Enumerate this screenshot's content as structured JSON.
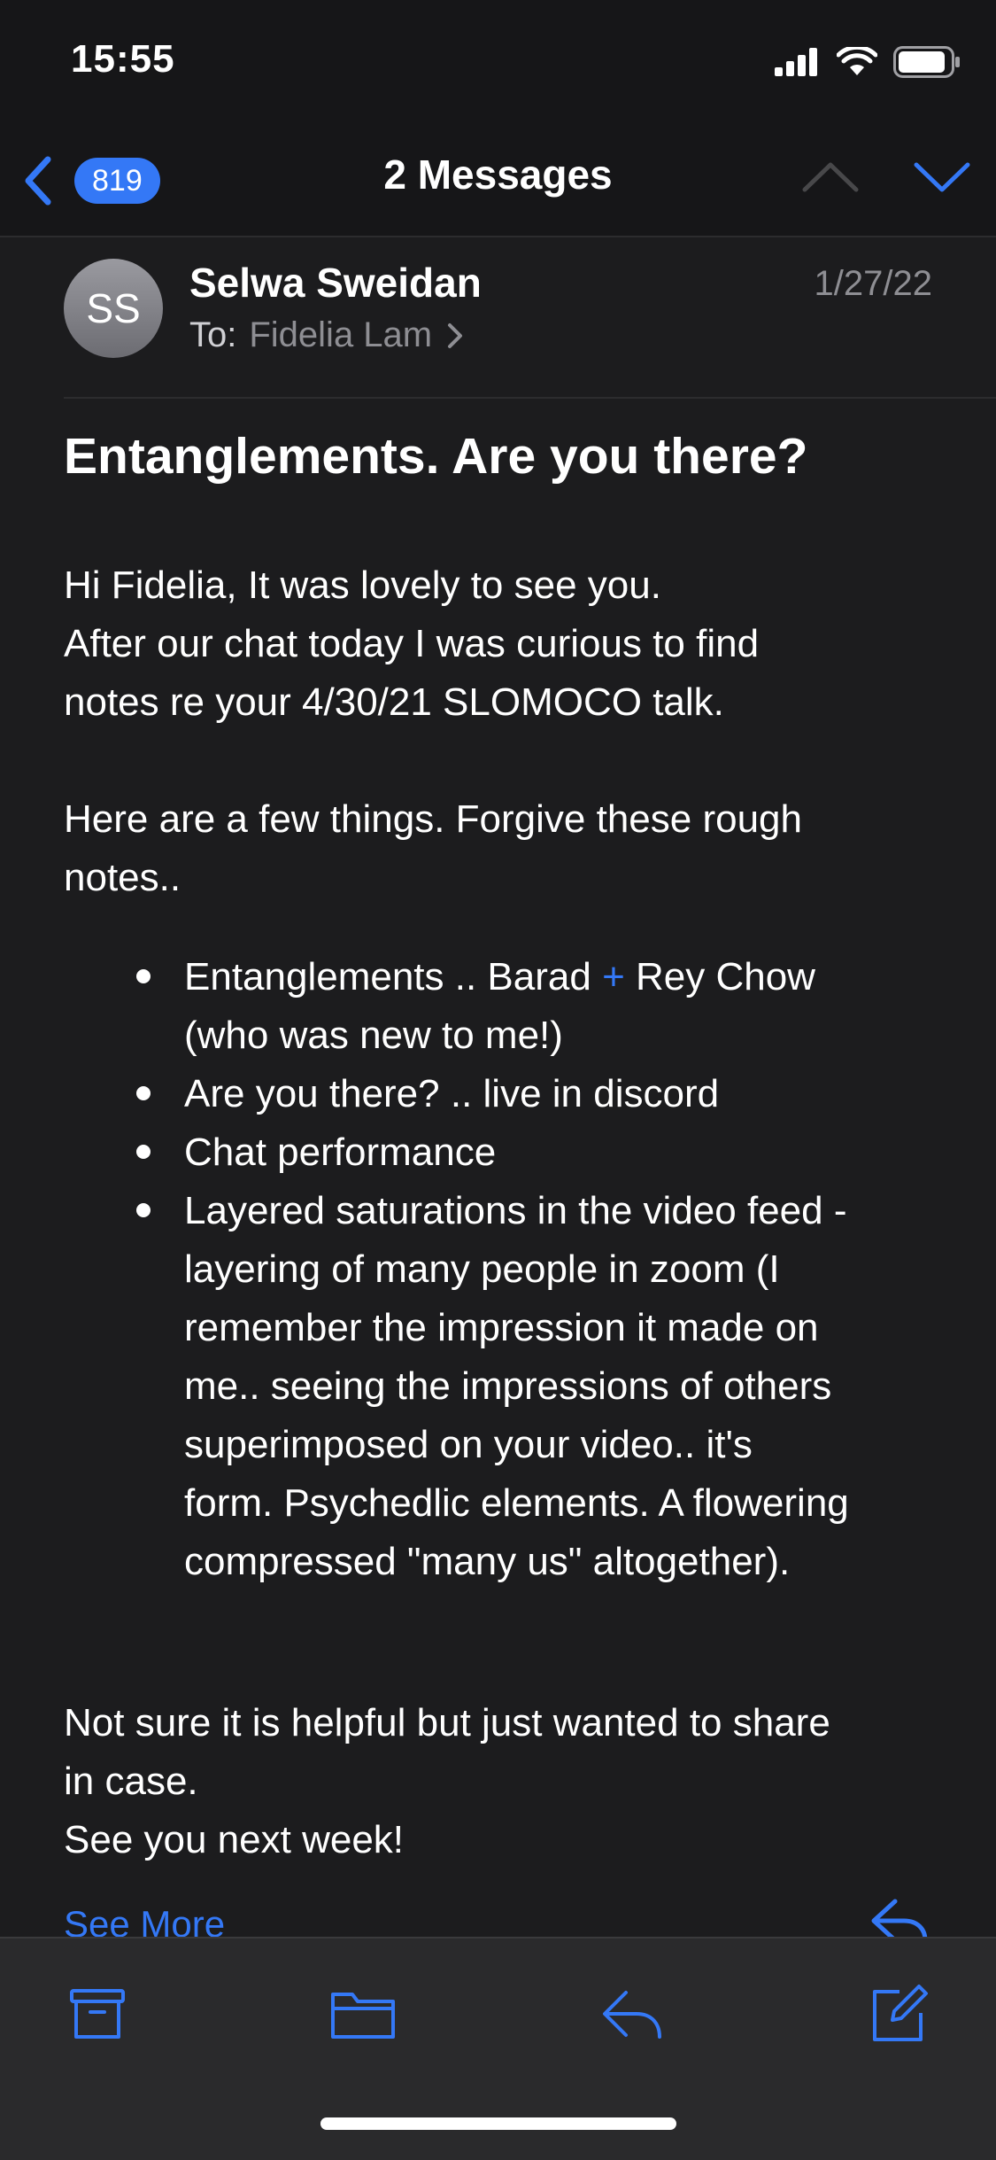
{
  "status_bar": {
    "time": "15:55"
  },
  "navbar": {
    "badge_count": "819",
    "title": "2 Messages"
  },
  "message": {
    "avatar_initials": "SS",
    "sender": "Selwa Sweidan",
    "to_label": "To:",
    "recipient": "Fidelia Lam",
    "date": "1/27/22",
    "subject": "Entanglements. Are you there?",
    "paragraphs": [
      "Hi Fidelia, It was lovely to see you.",
      "After our chat today I was curious to find",
      "notes re your 4/30/21 SLOMOCO talk.",
      "Here are a few things.  Forgive these rough",
      "notes.."
    ],
    "bullets": {
      "b1_part1": "Entanglements .. Barad ",
      "b1_plus": "+",
      "b1_part2": " Rey Chow",
      "b1_line2": "(who was new to me!)",
      "b2": "Are you there? .. live in discord",
      "b3": "Chat performance",
      "b4_lines": [
        "Layered saturations in the video feed -",
        "layering of many people in zoom (I",
        "remember the impression it made on",
        "me.. seeing the impressions of others",
        "superimposed on your video.. it's",
        "form. Psychedlic elements. A flowering",
        "compressed \"many us\" altogether)."
      ]
    },
    "closing": [
      "Not sure it is helpful but just wanted to share",
      "in case.",
      "See you next week!"
    ],
    "see_more": "See More"
  },
  "colors": {
    "accent": "#3478f6",
    "background": "#1c1c1e",
    "toolbar": "#2a2a2c"
  },
  "icons": [
    "back-chevron-icon",
    "chevron-up-icon",
    "chevron-down-icon",
    "archive-icon",
    "folder-icon",
    "reply-icon",
    "compose-icon",
    "signal-icon",
    "wifi-icon",
    "battery-icon"
  ]
}
